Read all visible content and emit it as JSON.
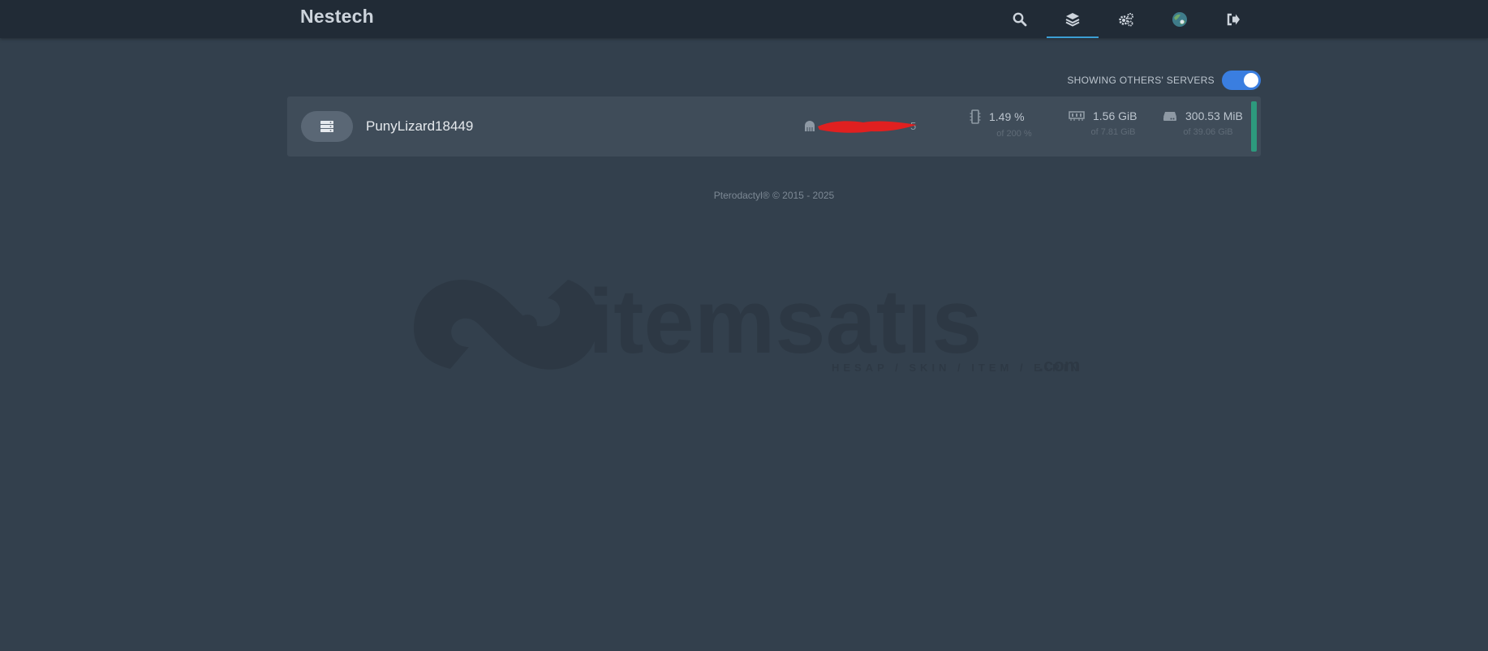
{
  "navbar": {
    "brand": "Nestech",
    "icons": [
      "search-icon",
      "layers-icon",
      "gears-icon",
      "avatar",
      "logout-icon"
    ]
  },
  "filter": {
    "toggle_label": "SHOWING OTHERS' SERVERS",
    "toggle_on": true
  },
  "servers": [
    {
      "name": "PunyLizard18449",
      "address_suffix": "5",
      "cpu": {
        "value": "1.49 %",
        "limit": "of 200 %"
      },
      "memory": {
        "value": "1.56 GiB",
        "limit": "of 7.81 GiB"
      },
      "disk": {
        "value": "300.53 MiB",
        "limit": "of 39.06 GiB"
      },
      "status_color": "#2d9a7d"
    }
  ],
  "footer": {
    "text": "Pterodactyl® © 2015 - 2025"
  },
  "watermark": {
    "brand": "itemsatıs",
    "tagline": "HESAP / SKIN / ITEM / E-PIN",
    "domain": ".com"
  },
  "colors": {
    "accent": "#3a7ee0",
    "background": "#33404d",
    "navbar": "#212b36"
  }
}
